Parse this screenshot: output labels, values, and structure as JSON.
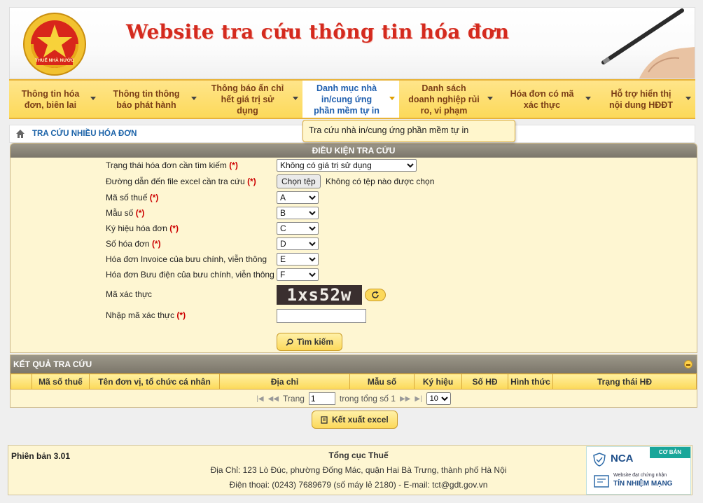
{
  "header": {
    "logo_text": "THUẾ NHÀ NƯỚC",
    "title": "Website tra cứu thông tin hóa đơn"
  },
  "nav": {
    "items": [
      {
        "label": "Thông tin hóa đơn, biên lai"
      },
      {
        "label": "Thông tin thông báo phát hành"
      },
      {
        "label": "Thông báo ấn chỉ hết giá trị sử dụng"
      },
      {
        "label": "Danh mục nhà in/cung ứng phần mềm tự in"
      },
      {
        "label": "Danh sách doanh nghiệp rủi ro, vi phạm"
      },
      {
        "label": "Hóa đơn có mã xác thực"
      },
      {
        "label": "Hỗ trợ hiển thị nội dung HĐĐT"
      }
    ],
    "active_index": 3,
    "dropdown_item": "Tra cứu nhà in/cung ứng phần mềm tự in"
  },
  "breadcrumb": {
    "text": "TRA CỨU NHIỀU HÓA ĐƠN"
  },
  "search": {
    "title": "ĐIỀU KIỆN TRA CỨU",
    "required_mark": "(*)",
    "fields": {
      "status_label": "Trạng thái hóa đơn cần tìm kiếm",
      "status_value": "Không có giá trị sử dụng",
      "file_label": "Đường dẫn đến file excel cần tra cứu",
      "file_button": "Chọn tệp",
      "file_text": "Không có tệp nào được chọn",
      "tax_code_label": "Mã số thuế",
      "tax_code_value": "A",
      "template_label": "Mẫu số",
      "template_value": "B",
      "symbol_label": "Ký hiệu hóa đơn",
      "symbol_value": "C",
      "number_label": "Số hóa đơn",
      "number_value": "D",
      "invoice_post_label": "Hóa đơn Invoice của bưu chính, viễn thông",
      "invoice_post_value": "E",
      "post_invoice_label": "Hóa đơn Bưu điện của bưu chính, viễn thông",
      "post_invoice_value": "F",
      "captcha_label": "Mã xác thực",
      "captcha_value": "1xs52w",
      "captcha_input_label": "Nhập mã xác thực",
      "captcha_input_value": ""
    },
    "search_button": "Tìm kiếm"
  },
  "results": {
    "title": "KẾT QUẢ TRA CỨU",
    "columns": [
      "",
      "Mã số thuế",
      "Tên đơn vị, tổ chức cá nhân",
      "Địa chỉ",
      "Mẫu số",
      "Ký hiệu",
      "Số HĐ",
      "Hình thức",
      "Trạng thái HĐ"
    ],
    "pager": {
      "page_label": "Trang",
      "page_value": "1",
      "total_text": "trong tổng số 1",
      "page_size": "10"
    },
    "export_button": "Kết xuất excel"
  },
  "footer": {
    "version": "Phiên bản 3.01",
    "org": "Tổng cục Thuế",
    "address": "Địa Chỉ: 123 Lò Đúc, phường Đống Mác, quận Hai Bà Trưng, thành phố Hà Nội",
    "contact": "Điện thoại: (0243) 7689679 (số máy lẻ 2180) - E-mail: tct@gdt.gov.vn",
    "badge": {
      "tag": "CƠ BẢN",
      "brand": "NCA",
      "subtitle": "Website đạt chứng nhận",
      "title": "TÍN NHIỆM MẠNG"
    }
  }
}
